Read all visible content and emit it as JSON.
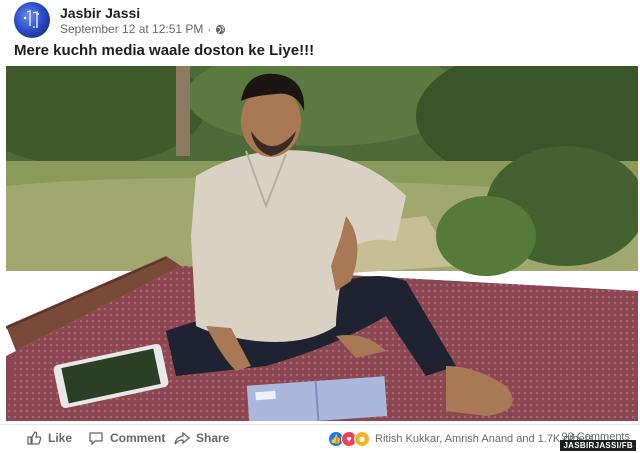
{
  "post": {
    "author": "Jasbir Jassi",
    "timestamp": "September 12 at 12:51 PM",
    "separator": "·",
    "privacy_icon": "globe-icon",
    "caption": "Mere kuchh media waale doston ke Liye!!!"
  },
  "photo": {
    "description_icon": "photo"
  },
  "actions": {
    "like_label": "Like",
    "comment_label": "Comment",
    "share_label": "Share"
  },
  "reactions": {
    "icons": [
      "like-reaction-icon",
      "love-reaction-icon",
      "haha-reaction-icon"
    ],
    "reactors_text": "Ritish Kukkar, Amrish Anand and 1.7K others",
    "comments_text": "90 Comments"
  },
  "watermark": "JASBIRJASSI/FB",
  "colors": {
    "like": "#1877f2",
    "love": "#f33e58",
    "haha": "#f7b125",
    "meta_text": "#65676b"
  }
}
